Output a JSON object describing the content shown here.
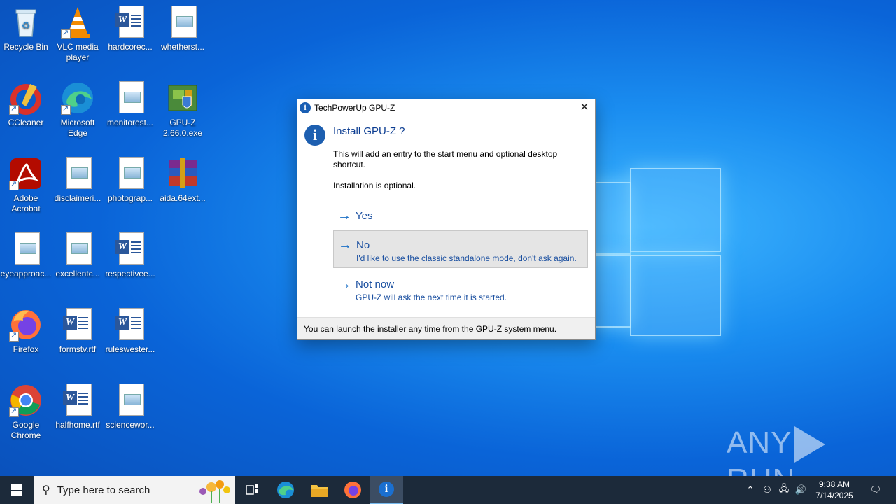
{
  "desktop": {
    "icons": [
      {
        "label": "Recycle Bin"
      },
      {
        "label": "VLC media player"
      },
      {
        "label": "hardcorec..."
      },
      {
        "label": "whetherst..."
      },
      {
        "label": "CCleaner"
      },
      {
        "label": "Microsoft Edge"
      },
      {
        "label": "monitorest..."
      },
      {
        "label": "GPU-Z 2.66.0.exe"
      },
      {
        "label": "Adobe Acrobat"
      },
      {
        "label": "disclaimeri..."
      },
      {
        "label": "photograp..."
      },
      {
        "label": "aida.64ext..."
      },
      {
        "label": "eyeapproac..."
      },
      {
        "label": "excellentc..."
      },
      {
        "label": "respectivee..."
      },
      {
        "label": "Firefox"
      },
      {
        "label": "formstv.rtf"
      },
      {
        "label": "ruleswester..."
      },
      {
        "label": "Google Chrome"
      },
      {
        "label": "halfhome.rtf"
      },
      {
        "label": "sciencewor..."
      }
    ]
  },
  "dialog": {
    "window_title": "TechPowerUp GPU-Z",
    "heading": "Install GPU-Z ?",
    "description": "This will add an entry to the start menu and optional desktop shortcut.",
    "optional_note": "Installation is optional.",
    "options": [
      {
        "title": "Yes",
        "subtitle": ""
      },
      {
        "title": "No",
        "subtitle": "I'd like to use the classic standalone mode, don't ask again."
      },
      {
        "title": "Not now",
        "subtitle": "GPU-Z will ask the next time it is started."
      }
    ],
    "footer": "You can launch the installer any time from the GPU-Z system menu."
  },
  "taskbar": {
    "search_placeholder": "Type here to search",
    "time": "9:38 AM",
    "date": "7/14/2025"
  },
  "watermark": {
    "left": "ANY",
    "right": "RUN"
  },
  "colors": {
    "accent": "#1a5fb4",
    "taskbar": "#1c2a3a",
    "desktop": "#0a64d8"
  }
}
